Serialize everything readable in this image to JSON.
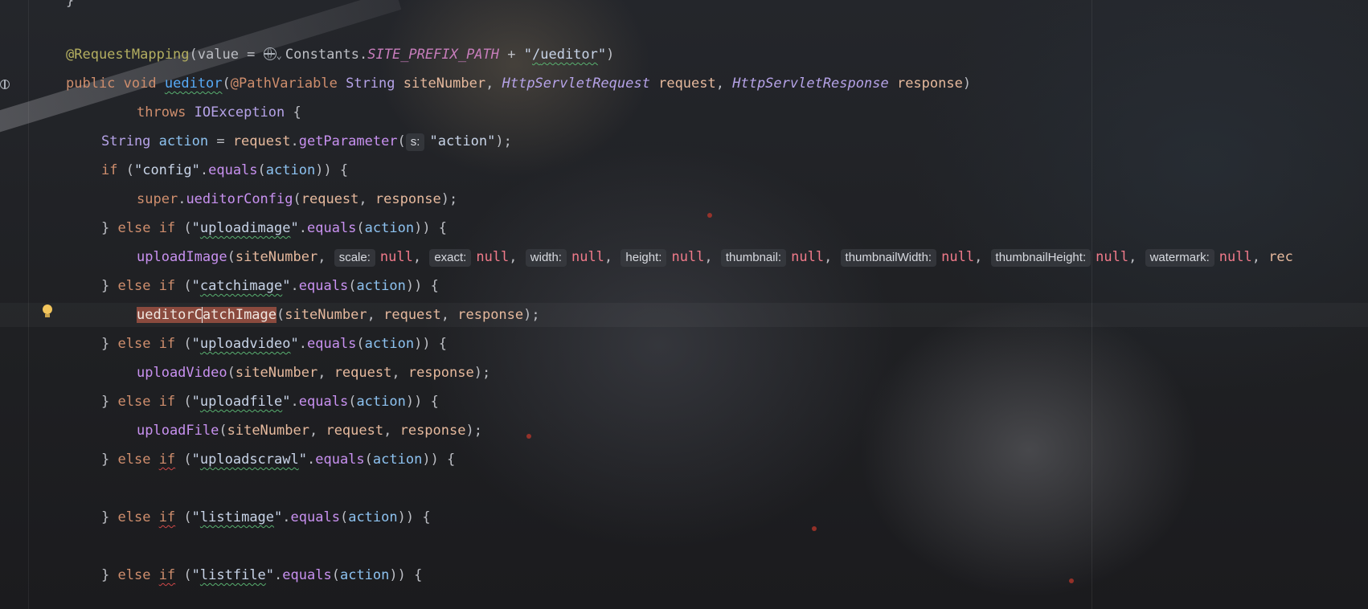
{
  "editor": {
    "colors": {
      "background": "#1e1f22",
      "keyword": "#cf8e6d",
      "annotation": "#b3ae60",
      "string": "#6aab73",
      "method": "#56a8f5",
      "selection": "#8a4a3e"
    },
    "gutter_icons": [
      "endpoint-globe-icon",
      "lightbulb-intention-icon"
    ],
    "lines": {
      "l0": "}",
      "l1": {
        "annotation": "@RequestMapping",
        "open": "(value = ",
        "icon": "globe-icon",
        "const_owner": "Constants.",
        "const_name": "SITE_PREFIX_PATH",
        "plus": " + ",
        "q1": "\"",
        "slash": "/",
        "path": "ueditor",
        "q2": "\"",
        "close": ")"
      },
      "l2": {
        "kw1": "public",
        "kw2": "void",
        "name": "ueditor",
        "paren": "(",
        "pv": "@PathVariable",
        "string_type": "String",
        "p1": "siteNumber",
        "comma1": ", ",
        "t2": "HttpServletRequest",
        "p2": "request",
        "comma2": ", ",
        "t3": "HttpServletResponse",
        "p3": "response",
        "close": ")"
      },
      "l3": {
        "kw": "throws",
        "type": "IOException",
        "brace": " {"
      },
      "l4": {
        "type": "String",
        "var": "action",
        "eq": " = ",
        "recv": "request",
        "dot": ".",
        "call": "getParameter",
        "open": "(",
        "hint": "s:",
        "arg": "\"action\"",
        "close": ");"
      },
      "l5": {
        "kw": "if",
        "open": " (",
        "str": "\"config\"",
        "dot": ".",
        "call": "equals",
        "arg_open": "(",
        "arg": "action",
        "close": ")) {"
      },
      "l6": {
        "kw": "super",
        "dot": ".",
        "call": "ueditorConfig",
        "open": "(",
        "a1": "request",
        "comma": ", ",
        "a2": "response",
        "close": ");"
      },
      "l7": {
        "brace": "} ",
        "kw1": "else",
        "kw2": "if",
        "open": " (",
        "q1": "\"",
        "str": "uploadimage",
        "q2": "\"",
        "dot": ".",
        "call": "equals",
        "arg_open": "(",
        "arg": "action",
        "close": ")) {"
      },
      "l8": {
        "call": "uploadImage",
        "open": "(",
        "a1": "siteNumber",
        "comma": ", ",
        "hints": [
          {
            "label": "scale:",
            "value": "null"
          },
          {
            "label": "exact:",
            "value": "null"
          },
          {
            "label": "width:",
            "value": "null"
          },
          {
            "label": "height:",
            "value": "null"
          },
          {
            "label": "thumbnail:",
            "value": "null"
          },
          {
            "label": "thumbnailWidth:",
            "value": "null"
          },
          {
            "label": "thumbnailHeight:",
            "value": "null"
          },
          {
            "label": "watermark:",
            "value": "null"
          }
        ],
        "tail": "rec"
      },
      "l9": {
        "brace": "} ",
        "kw1": "else",
        "kw2": "if",
        "open": " (",
        "q1": "\"",
        "str": "catchimage",
        "q2": "\"",
        "dot": ".",
        "call": "equals",
        "arg_open": "(",
        "arg": "action",
        "close": ")) {"
      },
      "l10": {
        "sel_a": "ueditorC",
        "sel_b": "atchImage",
        "open": "(",
        "a1": "siteNumber",
        "c1": ", ",
        "a2": "request",
        "c2": ", ",
        "a3": "response",
        "close": ");"
      },
      "l11": {
        "brace": "} ",
        "kw1": "else",
        "kw2": "if",
        "open": " (",
        "q1": "\"",
        "str": "uploadvideo",
        "q2": "\"",
        "dot": ".",
        "call": "equals",
        "arg_open": "(",
        "arg": "action",
        "close": ")) {"
      },
      "l12": {
        "call": "uploadVideo",
        "open": "(",
        "a1": "siteNumber",
        "c1": ", ",
        "a2": "request",
        "c2": ", ",
        "a3": "response",
        "close": ");"
      },
      "l13": {
        "brace": "} ",
        "kw1": "else",
        "kw2": "if",
        "open": " (",
        "q1": "\"",
        "str": "uploadfile",
        "q2": "\"",
        "dot": ".",
        "call": "equals",
        "arg_open": "(",
        "arg": "action",
        "close": ")) {"
      },
      "l14": {
        "call": "uploadFile",
        "open": "(",
        "a1": "siteNumber",
        "c1": ", ",
        "a2": "request",
        "c2": ", ",
        "a3": "response",
        "close": ");"
      },
      "l15": {
        "brace": "} ",
        "kw1": "else",
        "kw2": "if",
        "open": " (",
        "q1": "\"",
        "str": "uploadscrawl",
        "q2": "\"",
        "dot": ".",
        "call": "equals",
        "arg_open": "(",
        "arg": "action",
        "close": ")) {"
      },
      "l17": {
        "brace": "} ",
        "kw1": "else",
        "kw2": "if",
        "open": " (",
        "q1": "\"",
        "str": "listimage",
        "q2": "\"",
        "dot": ".",
        "call": "equals",
        "arg_open": "(",
        "arg": "action",
        "close": ")) {"
      },
      "l19": {
        "brace": "} ",
        "kw1": "else",
        "kw2": "if",
        "open": " (",
        "q1": "\"",
        "str": "listfile",
        "q2": "\"",
        "dot": ".",
        "call": "equals",
        "arg_open": "(",
        "arg": "action",
        "close": ")) {"
      }
    }
  }
}
